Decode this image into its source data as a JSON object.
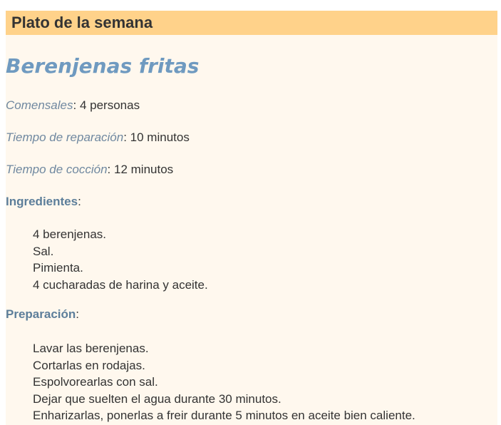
{
  "header": {
    "title": "Plato de la semana"
  },
  "recipe": {
    "title": "Berenjenas fritas",
    "servings": {
      "label": "Comensales",
      "sep": ":",
      "value": " 4 personas"
    },
    "prep_time": {
      "label": "Tiempo de reparación",
      "sep": ":",
      "value": " 10 minutos"
    },
    "cook_time": {
      "label": "Tiempo de cocción",
      "sep": ":",
      "value": " 12 minutos"
    },
    "ingredients": {
      "heading": "Ingredientes",
      "sep": ":",
      "items": [
        "4 berenjenas.",
        "Sal.",
        "Pimienta.",
        "4 cucharadas de harina y aceite."
      ]
    },
    "preparation": {
      "heading": "Preparación",
      "sep": ":",
      "items": [
        "Lavar las berenjenas.",
        "Cortarlas en rodajas.",
        "Espolvorearlas con sal.",
        "Dejar que suelten el agua durante 30 minutos.",
        "Enharizarlas, ponerlas a freir durante 5 minutos en aceite bien caliente."
      ]
    }
  },
  "colors": {
    "header_bg": "#ffd28a",
    "panel_bg": "#fff8ee",
    "title_color": "#6f9ac0",
    "label_color": "#6f88a0",
    "heading_color": "#5c7e9a",
    "text_color": "#333333"
  }
}
